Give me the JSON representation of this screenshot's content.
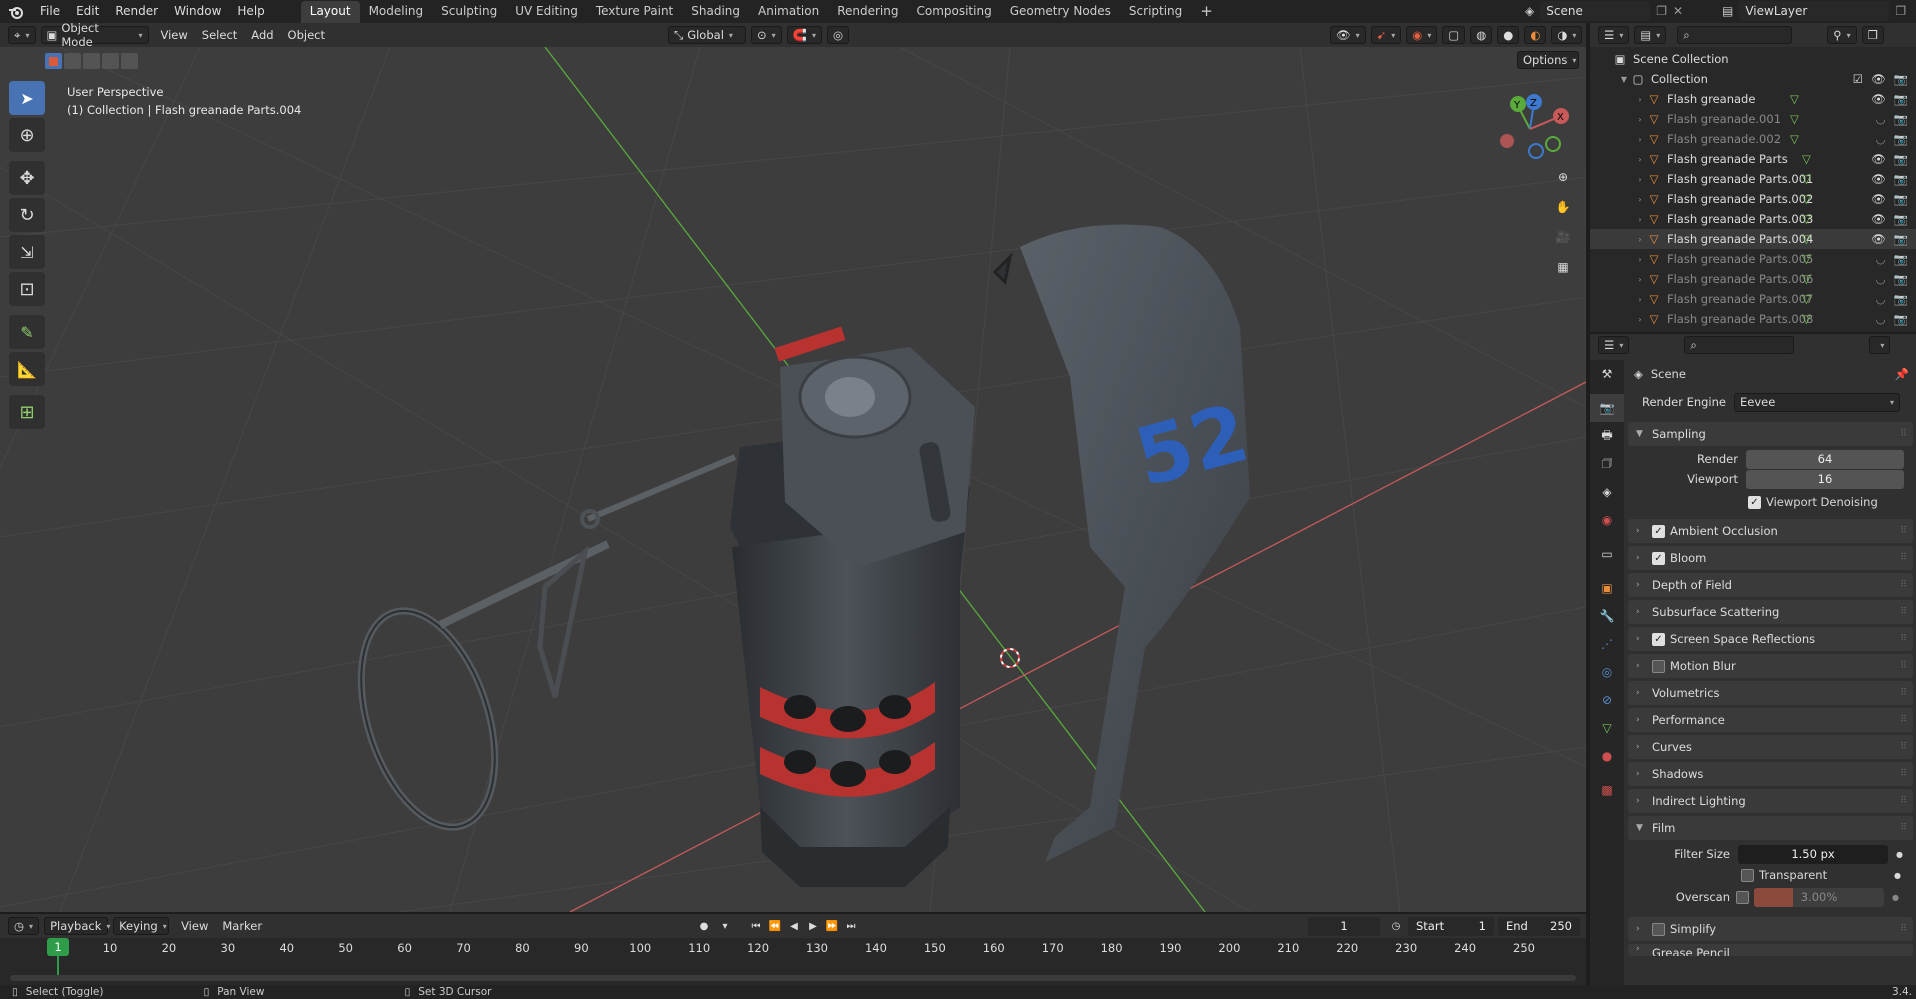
{
  "menubar": {
    "items": [
      "File",
      "Edit",
      "Render",
      "Window",
      "Help"
    ],
    "workspace_tabs": [
      "Layout",
      "Modeling",
      "Sculpting",
      "UV Editing",
      "Texture Paint",
      "Shading",
      "Animation",
      "Rendering",
      "Compositing",
      "Geometry Nodes",
      "Scripting"
    ],
    "active_tab": "Layout",
    "scene_name": "Scene",
    "view_layer": "ViewLayer"
  },
  "viewport_header": {
    "mode": "Object Mode",
    "menus": [
      "View",
      "Select",
      "Add",
      "Object"
    ],
    "orientation": "Global",
    "options_label": "Options"
  },
  "viewport": {
    "perspective_label": "User Perspective",
    "collection_label": "(1) Collection | Flash greanade Parts.004",
    "gizmo_axes": [
      "Y",
      "Z",
      "X"
    ],
    "decal_text": "52"
  },
  "outliner": {
    "root": "Scene Collection",
    "collection": "Collection",
    "items": [
      {
        "name": "Flash greanade",
        "visible": true
      },
      {
        "name": "Flash greanade.001",
        "visible": false
      },
      {
        "name": "Flash greanade.002",
        "visible": false
      },
      {
        "name": "Flash greanade Parts",
        "visible": true
      },
      {
        "name": "Flash greanade Parts.001",
        "visible": true
      },
      {
        "name": "Flash greanade Parts.002",
        "visible": true
      },
      {
        "name": "Flash greanade Parts.003",
        "visible": true
      },
      {
        "name": "Flash greanade Parts.004",
        "visible": true
      },
      {
        "name": "Flash greanade Parts.005",
        "visible": false
      },
      {
        "name": "Flash greanade Parts.006",
        "visible": false
      },
      {
        "name": "Flash greanade Parts.007",
        "visible": false
      },
      {
        "name": "Flash greanade Parts.008",
        "visible": false
      }
    ]
  },
  "properties": {
    "context": "Scene",
    "render_engine_label": "Render Engine",
    "render_engine": "Eevee",
    "sampling": {
      "title": "Sampling",
      "render_label": "Render",
      "render_value": "64",
      "viewport_label": "Viewport",
      "viewport_value": "16",
      "denoise_label": "Viewport Denoising"
    },
    "panels": [
      {
        "label": "Ambient Occlusion",
        "checkbox": true,
        "checked": true
      },
      {
        "label": "Bloom",
        "checkbox": true,
        "checked": true
      },
      {
        "label": "Depth of Field",
        "checkbox": false
      },
      {
        "label": "Subsurface Scattering",
        "checkbox": false
      },
      {
        "label": "Screen Space Reflections",
        "checkbox": true,
        "checked": true
      },
      {
        "label": "Motion Blur",
        "checkbox": true,
        "checked": false
      },
      {
        "label": "Volumetrics",
        "checkbox": false
      },
      {
        "label": "Performance",
        "checkbox": false
      },
      {
        "label": "Curves",
        "checkbox": false
      },
      {
        "label": "Shadows",
        "checkbox": false
      },
      {
        "label": "Indirect Lighting",
        "checkbox": false
      }
    ],
    "film": {
      "title": "Film",
      "filter_label": "Filter Size",
      "filter_value": "1.50 px",
      "transparent_label": "Transparent",
      "overscan_label": "Overscan",
      "overscan_value": "3.00%"
    },
    "simplify_label": "Simplify",
    "cut_label": "Grease Pencil"
  },
  "timeline": {
    "menus": [
      "Playback",
      "Keying",
      "View",
      "Marker"
    ],
    "current_frame": "1",
    "start_label": "Start",
    "start_value": "1",
    "end_label": "End",
    "end_value": "250",
    "ticks": [
      "10",
      "20",
      "30",
      "40",
      "50",
      "60",
      "70",
      "80",
      "90",
      "100",
      "110",
      "120",
      "130",
      "140",
      "150",
      "160",
      "170",
      "180",
      "190",
      "200",
      "210",
      "220",
      "230",
      "240",
      "250"
    ],
    "playhead": "1"
  },
  "statusbar": {
    "select": "Select (Toggle)",
    "pan": "Pan View",
    "cursor": "Set 3D Cursor",
    "version": "3.4."
  },
  "colors": {
    "accent": "#4772b3",
    "playhead": "#2e9c48",
    "mesh_icon": "#e88d3c",
    "axis_x": "#c85a5a",
    "axis_y": "#5aaa3c",
    "axis_z": "#3c7ad0"
  }
}
